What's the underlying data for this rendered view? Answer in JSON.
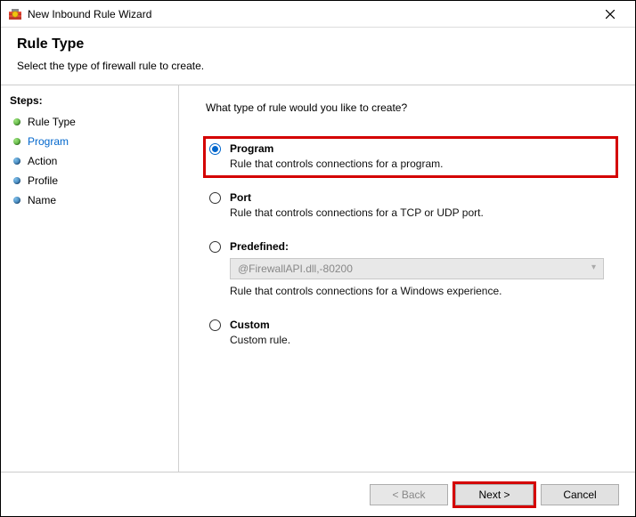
{
  "window": {
    "title": "New Inbound Rule Wizard"
  },
  "header": {
    "title": "Rule Type",
    "subtitle": "Select the type of firewall rule to create."
  },
  "sidebar": {
    "steps_label": "Steps:",
    "items": [
      {
        "label": "Rule Type",
        "bullet": "green",
        "current": false
      },
      {
        "label": "Program",
        "bullet": "green",
        "current": true
      },
      {
        "label": "Action",
        "bullet": "blue",
        "current": false
      },
      {
        "label": "Profile",
        "bullet": "blue",
        "current": false
      },
      {
        "label": "Name",
        "bullet": "blue",
        "current": false
      }
    ]
  },
  "main": {
    "prompt": "What type of rule would you like to create?",
    "options": [
      {
        "key": "program",
        "title": "Program",
        "desc": "Rule that controls connections for a program.",
        "checked": true,
        "highlight": true
      },
      {
        "key": "port",
        "title": "Port",
        "desc": "Rule that controls connections for a TCP or UDP port.",
        "checked": false
      },
      {
        "key": "predefined",
        "title": "Predefined:",
        "desc": "Rule that controls connections for a Windows experience.",
        "checked": false,
        "select_value": "@FirewallAPI.dll,-80200",
        "select_disabled": true
      },
      {
        "key": "custom",
        "title": "Custom",
        "desc": "Custom rule.",
        "checked": false
      }
    ]
  },
  "footer": {
    "back": "< Back",
    "next": "Next >",
    "cancel": "Cancel",
    "back_disabled": true,
    "next_highlight": true
  }
}
